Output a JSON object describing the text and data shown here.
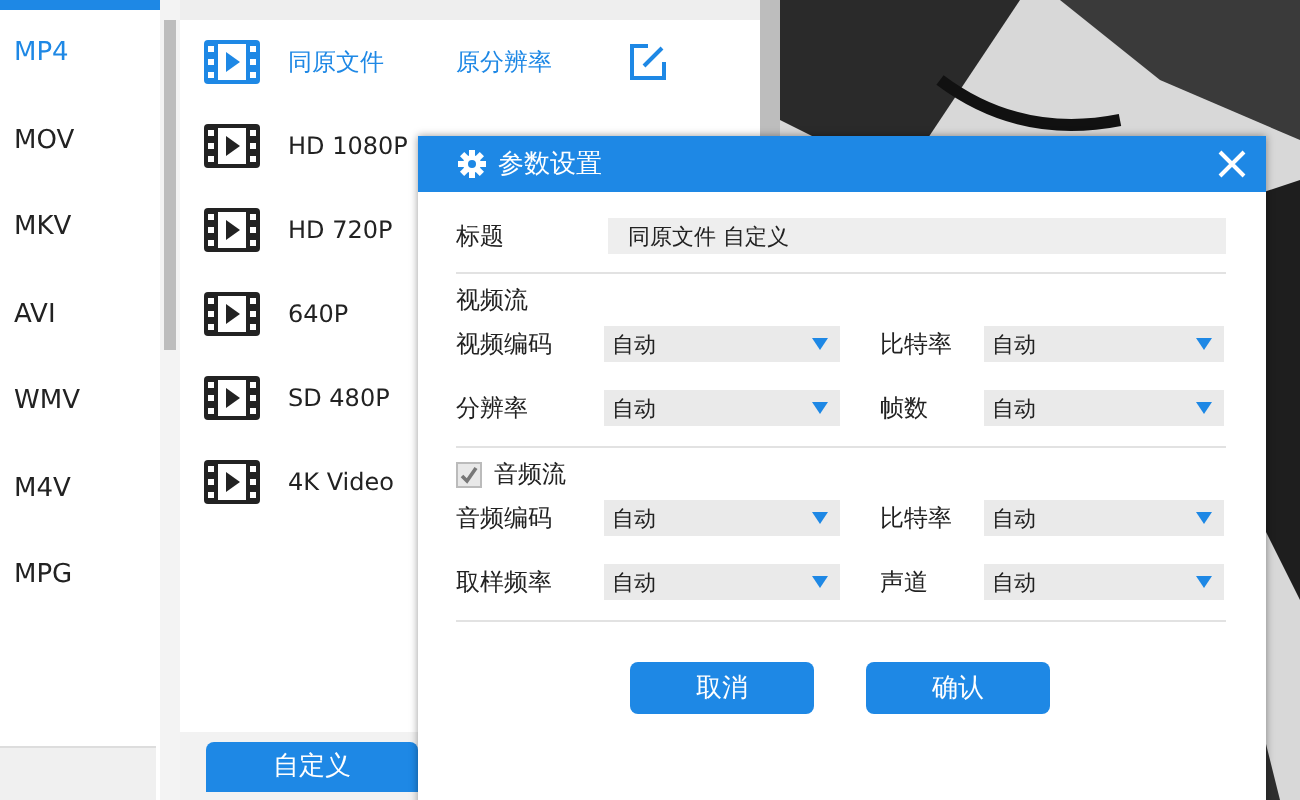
{
  "formats": [
    {
      "label": "MP4",
      "selected": true
    },
    {
      "label": "MOV",
      "selected": false
    },
    {
      "label": "MKV",
      "selected": false
    },
    {
      "label": "AVI",
      "selected": false
    },
    {
      "label": "WMV",
      "selected": false
    },
    {
      "label": "M4V",
      "selected": false
    },
    {
      "label": "MPG",
      "selected": false
    }
  ],
  "presets": [
    {
      "name": "同原文件",
      "resolution": "原分辨率",
      "selected": true
    },
    {
      "name": "HD 1080P",
      "selected": false
    },
    {
      "name": "HD 720P",
      "selected": false
    },
    {
      "name": "640P",
      "selected": false
    },
    {
      "name": "SD 480P",
      "selected": false
    },
    {
      "name": "4K Video",
      "selected": false
    }
  ],
  "custom_button": "自定义",
  "dialog": {
    "title": "参数设置",
    "title_field": {
      "label": "标题",
      "value": "同原文件 自定义"
    },
    "video": {
      "heading": "视频流",
      "fields": [
        {
          "label": "视频编码",
          "value": "自动"
        },
        {
          "label": "比特率",
          "value": "自动"
        },
        {
          "label": "分辨率",
          "value": "自动"
        },
        {
          "label": "帧数",
          "value": "自动"
        }
      ]
    },
    "audio": {
      "heading": "音频流",
      "checked": true,
      "disabled": true,
      "fields": [
        {
          "label": "音频编码",
          "value": "自动"
        },
        {
          "label": "比特率",
          "value": "自动"
        },
        {
          "label": "取样频率",
          "value": "自动"
        },
        {
          "label": "声道",
          "value": "自动"
        }
      ]
    },
    "buttons": [
      "取消",
      "确认"
    ]
  }
}
